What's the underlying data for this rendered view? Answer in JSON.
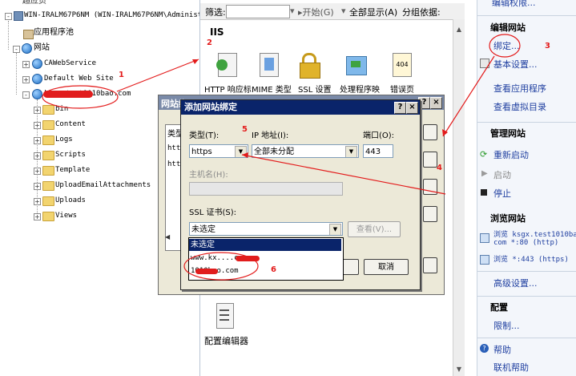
{
  "tree": {
    "top_partial": "超应页",
    "server": "WIN-IRALM67P6NM (WIN-IRALM67P6NM\\Administrator)",
    "app_pools": "应用程序池",
    "sites": "网站",
    "site_items": [
      "CAWebService",
      "Default Web Site",
      "ksgx.test1010bao.com"
    ],
    "folders": [
      "bin",
      "Content",
      "Logs",
      "Scripts",
      "Template",
      "UploadEmailAttachments",
      "Uploads",
      "Views"
    ]
  },
  "filter_bar": {
    "label": "筛选:",
    "start_label": "开始(G)",
    "show_all": "全部显示(A)",
    "group_by": "分组依据:"
  },
  "center": {
    "section": "IIS",
    "icons": [
      "HTTP 响应标",
      "MIME 类型",
      "SSL 设置",
      "处理程序映",
      "错误页"
    ],
    "config_editor": "配置编辑器"
  },
  "right_pane": {
    "top_partial": "编辑权限...",
    "edit_site_header": "编辑网站",
    "binding_link": "绑定...",
    "basic_settings": "基本设置...",
    "view_apps": "查看应用程序",
    "view_vdirs": "查看虚拟目录",
    "manage_site_header": "管理网站",
    "restart": "重新启动",
    "start": "启动",
    "stop": "停止",
    "browse_header": "浏览网站",
    "browse_80_line1": "浏览 ksgx.test1010bao.",
    "browse_80_line2": "com *:80 (http)",
    "browse_443": "浏览 *:443 (https)",
    "advanced": "高级设置...",
    "config_header": "配置",
    "limits": "限制...",
    "help": "帮助",
    "online_help": "联机帮助"
  },
  "bg_dialog": {
    "title": "网站绑",
    "col_type": "类型",
    "rows": [
      "http",
      "http"
    ]
  },
  "dialog": {
    "title": "添加网站绑定",
    "type_label": "类型(T):",
    "type_value": "https",
    "ip_label": "IP 地址(I):",
    "ip_value": "全部未分配",
    "port_label": "端口(O):",
    "port_value": "443",
    "host_label": "主机名(H):",
    "host_value": "",
    "ssl_label": "SSL 证书(S):",
    "ssl_value": "未选定",
    "view_button": "查看(V)...",
    "cancel_button": "取消",
    "ok_button": "",
    "ssl_options": [
      "未选定",
      "www.kx....com",
      "1010bao.com"
    ]
  },
  "annotations": [
    "1",
    "2",
    "3",
    "4",
    "5",
    "6"
  ],
  "colors": {
    "dialog_title": "#0a246a",
    "annotation": "#e31b1b",
    "selected_option": "#0a246a",
    "link": "#1f3fa0"
  }
}
